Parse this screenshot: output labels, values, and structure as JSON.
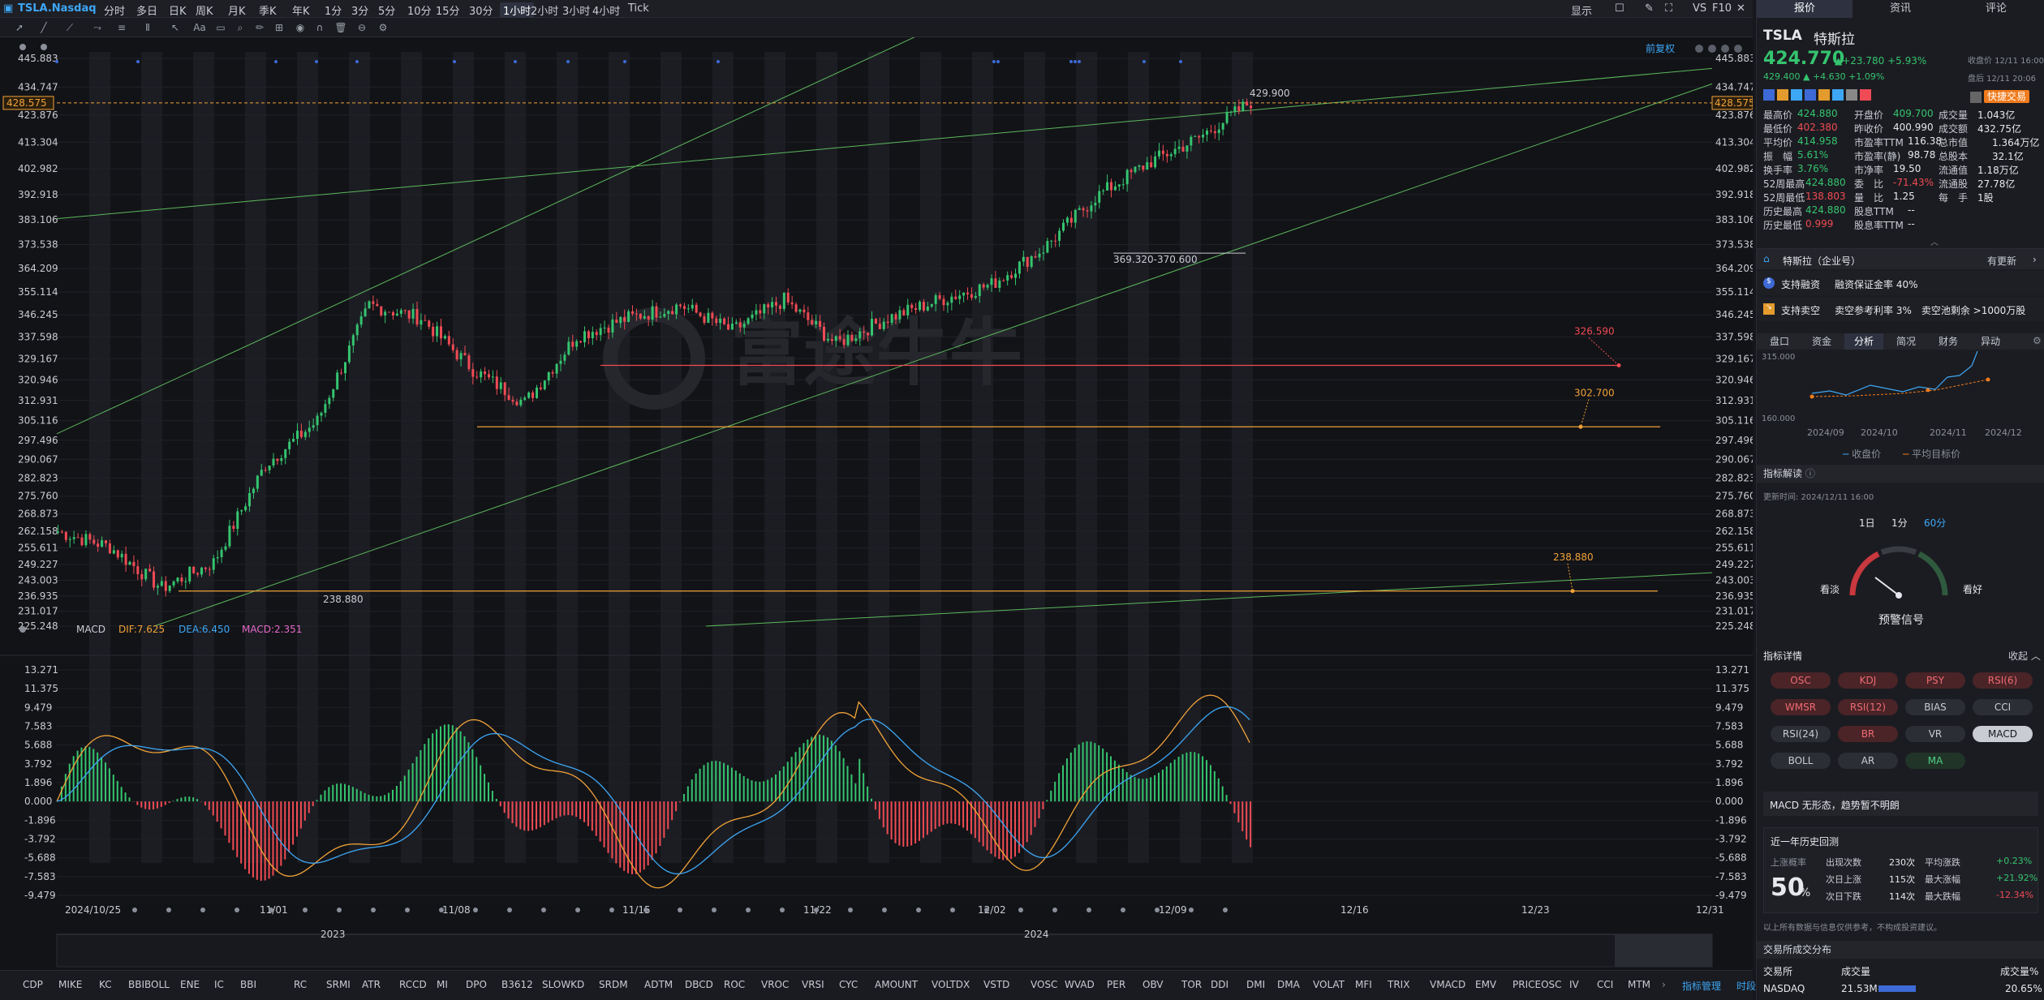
{
  "toolbar": {
    "symbol": "TSLA.Nasdaq",
    "periods": [
      "分时",
      "多日",
      "日K",
      "周K",
      "月K",
      "季K",
      "年K",
      "1分",
      "3分",
      "5分",
      "10分",
      "15分",
      "30分",
      "1小时",
      "2小时",
      "3小时",
      "4小时",
      "Tick"
    ],
    "active": "1小时",
    "right": [
      "显示",
      "VS",
      "F10"
    ]
  },
  "chart": {
    "right_label": "前复权",
    "price_ticks": [
      "445.883",
      "434.747",
      "423.876",
      "413.304",
      "402.982",
      "392.918",
      "383.106",
      "373.538",
      "364.209",
      "355.114",
      "346.245",
      "337.598",
      "329.167",
      "320.946",
      "312.931",
      "305.116",
      "297.496",
      "290.067",
      "282.823",
      "275.760",
      "268.873",
      "262.158",
      "255.611",
      "249.227",
      "243.003",
      "236.935",
      "231.017",
      "225.248"
    ],
    "price_tag": "428.575",
    "annotations": {
      "high": "429.900",
      "range": "369.320-370.600",
      "level1": "326.590",
      "level2": "302.700",
      "level3": "238.880",
      "low": "238.880"
    },
    "watermark": "富途牛牛",
    "macd": {
      "title": "MACD",
      "dif": "DIF:7.625",
      "dea": "DEA:6.450",
      "macd": "MACD:2.351",
      "ticks": [
        "13.271",
        "11.375",
        "9.479",
        "7.583",
        "5.688",
        "3.792",
        "1.896",
        "0.000",
        "-1.896",
        "-3.792",
        "-5.688",
        "-7.583",
        "-9.479"
      ]
    },
    "dates": [
      "2024/10/25",
      "11/01",
      "11/08",
      "11/15",
      "11/22",
      "12/02",
      "12/09",
      "12/16",
      "12/23",
      "12/31"
    ],
    "nav": [
      "2023",
      "2024"
    ]
  },
  "chart_data": {
    "type": "candlestick",
    "title": "TSLA.Nasdaq 1小时",
    "ylim": [
      225.248,
      445.883
    ],
    "x": [
      "2024/10/25",
      "11/01",
      "11/08",
      "11/15",
      "11/22",
      "12/02",
      "12/09",
      "12/16",
      "12/23",
      "12/31"
    ],
    "series": [
      {
        "name": "close",
        "values": [
          262,
          256,
          240,
          250,
          288,
          305,
          350,
          345,
          325,
          312,
          338,
          345,
          350,
          340,
          352,
          335,
          345,
          352,
          358,
          372,
          392,
          405,
          415,
          429
        ]
      }
    ],
    "levels": [
      {
        "name": "326.590",
        "value": 326.59
      },
      {
        "name": "302.700",
        "value": 302.7
      },
      {
        "name": "238.880",
        "value": 238.88
      }
    ],
    "macd": {
      "dif": 7.625,
      "dea": 6.45,
      "macd": 2.351,
      "ylim": [
        -9.479,
        13.271
      ]
    }
  },
  "indicators": [
    "CDP",
    "MIKE",
    "KC",
    "BBIBOLL",
    "ENE",
    "IC",
    "BBI",
    "RC",
    "SRMI",
    "ATR",
    "RCCD",
    "MI",
    "DPO",
    "B3612",
    "SLOWKD",
    "SRDM",
    "ADTM",
    "DBCD",
    "ROC",
    "VROC",
    "VRSI",
    "CYC",
    "AMOUNT",
    "VOLTDX",
    "VSTD",
    "VOSC",
    "WVAD",
    "PER",
    "OBV",
    "TOR",
    "DDI",
    "DMI",
    "DMA",
    "VOLAT",
    "MFI",
    "TRIX",
    "VMACD",
    "EMV",
    "PRICEOSC",
    "IV",
    "CCI",
    "MTM"
  ],
  "indicators_right": [
    "指标管理",
    "时段"
  ],
  "panel": {
    "tabs": [
      "报价",
      "资讯",
      "评论"
    ],
    "ticker": "TSLA",
    "name": "特斯拉",
    "price": "424.770",
    "change": "+23.780",
    "pct": "+5.93%",
    "close_time": "收盘价 12/11 16:00",
    "after_price": "429.400",
    "after_change": "+4.630",
    "after_pct": "+1.09%",
    "after_time": "盘后 12/11 20:06",
    "quick": "快捷交易",
    "stats": [
      [
        "最高价",
        "424.880",
        "开盘价",
        "409.700",
        "成交量",
        "1.043亿"
      ],
      [
        "最低价",
        "402.380",
        "昨收价",
        "400.990",
        "成交额",
        "432.75亿"
      ],
      [
        "平均价",
        "414.958",
        "市盈率TTM",
        "116.38",
        "总市值",
        "1.364万亿"
      ],
      [
        "振　幅",
        "5.61%",
        "市盈率(静)",
        "98.78",
        "总股本",
        "32.1亿"
      ],
      [
        "换手率",
        "3.76%",
        "市净率",
        "19.50",
        "流通值",
        "1.18万亿"
      ],
      [
        "52周最高",
        "424.880",
        "委　比",
        "-71.43%",
        "流通股",
        "27.78亿"
      ],
      [
        "52周最低",
        "138.803",
        "量　比",
        "1.25",
        "每　手",
        "1股"
      ],
      [
        "历史最高",
        "424.880",
        "股息TTM",
        "--",
        "",
        ""
      ],
      [
        "历史最低",
        "0.999",
        "股息率TTM",
        "--",
        "",
        ""
      ]
    ],
    "company": "特斯拉（企业号）",
    "company_right": "有更新",
    "margin": "支持融资",
    "margin_rate": "融资保证金率 40%",
    "short": "支持卖空",
    "short_info": "卖空参考利率 3%　卖空池剩余 >1000万股",
    "subtabs": [
      "盘口",
      "资金",
      "分析",
      "简况",
      "财务",
      "异动"
    ],
    "subtab_active": "分析",
    "mini_chart": {
      "y_labels": [
        "315.000",
        "160.000"
      ],
      "x_labels": [
        "2024/09",
        "2024/10",
        "2024/11",
        "2024/12"
      ],
      "legend": [
        "收盘价",
        "平均目标价"
      ]
    },
    "signal": {
      "title": "指标解读",
      "updated": "更新时间: 2024/12/11 16:00",
      "periods": [
        "1日",
        "1分",
        "60分"
      ],
      "active": "60分",
      "bear": "看淡",
      "bull": "看好",
      "label": "预警信号"
    },
    "detail": {
      "title": "指标详情",
      "collapse": "收起",
      "buttons": [
        [
          "OSC",
          "r"
        ],
        [
          "KDJ",
          "r"
        ],
        [
          "PSY",
          "r"
        ],
        [
          "RSI(6)",
          "r"
        ],
        [
          "WMSR",
          "r"
        ],
        [
          "RSI(12)",
          "r"
        ],
        [
          "BIAS",
          "d"
        ],
        [
          "CCI",
          "d"
        ],
        [
          "RSI(24)",
          "d"
        ],
        [
          "BR",
          "r"
        ],
        [
          "VR",
          "d"
        ],
        [
          "MACD",
          "s"
        ],
        [
          "BOLL",
          "d"
        ],
        [
          "AR",
          "d"
        ],
        [
          "MA",
          "gr2"
        ]
      ],
      "macd_note": "MACD 无形态，趋势暂不明朗"
    },
    "history": {
      "title": "近一年历史回测",
      "up_prob_label": "上涨概率",
      "up_prob": "50",
      "pct_sign": "%",
      "rows": [
        [
          "出现次数",
          "230次",
          "平均涨跌",
          "+0.23%"
        ],
        [
          "次日上涨",
          "115次",
          "最大涨幅",
          "+21.92%"
        ],
        [
          "次日下跌",
          "114次",
          "最大跌幅",
          "-12.34%"
        ]
      ],
      "disclaimer": "以上所有数据与信息仅供参考，不构成投资建议。"
    },
    "exchange": {
      "title": "交易所成交分布",
      "cols": [
        "交易所",
        "成交量",
        "成交量%"
      ],
      "row": [
        "NASDAQ",
        "21.53M",
        "20.65%"
      ]
    }
  },
  "colors": {
    "up": "#35c46f",
    "down": "#ef4b54",
    "accent": "#f0a238",
    "dif": "#f0a238",
    "dea": "#3da7f5",
    "trend": "#5cb85c"
  }
}
